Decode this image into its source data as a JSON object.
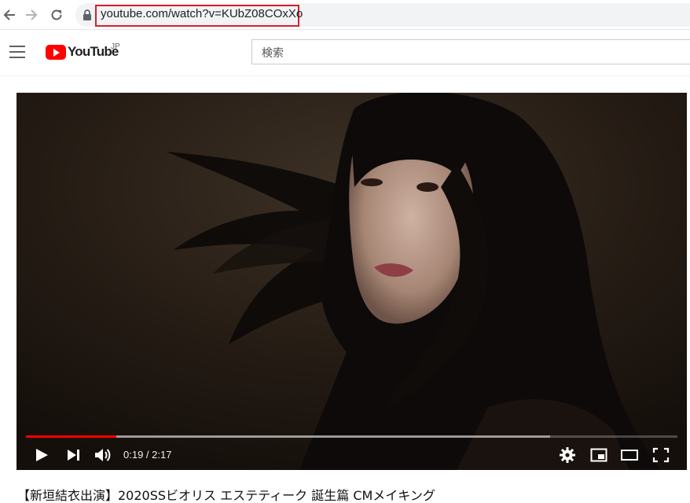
{
  "browser": {
    "url": "youtube.com/watch?v=KUbZ08COxXo",
    "icons": [
      "back-arrow-icon",
      "forward-arrow-icon",
      "reload-icon",
      "lock-icon"
    ],
    "highlight_color": "#d6202e"
  },
  "header": {
    "logo_text": "YouTube",
    "region": "JP",
    "search_placeholder": "検索"
  },
  "player": {
    "current_time": "0:19",
    "duration": "2:17",
    "time_display": "0:19 / 2:17",
    "progress_fraction": 0.139,
    "buffered_fraction": 0.805,
    "progress_color": "#ff0000"
  },
  "video": {
    "title": "【新垣結衣出演】2020SSビオリス エステティーク 誕生篇 CMメイキング"
  }
}
